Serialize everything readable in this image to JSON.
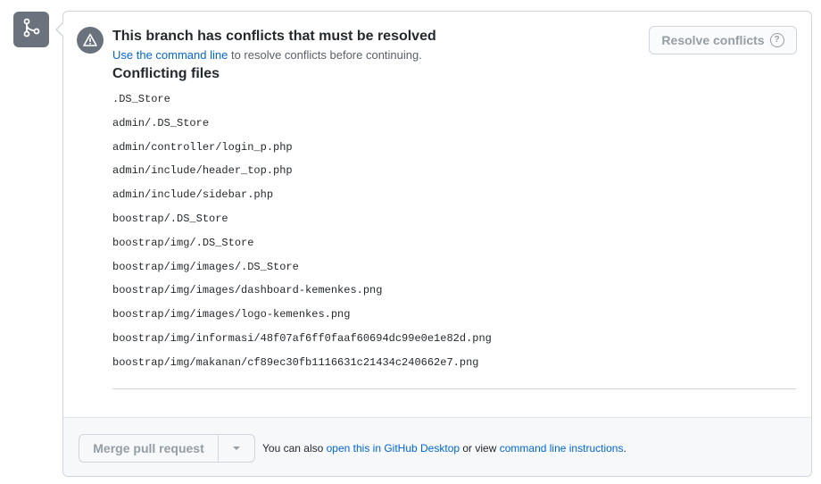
{
  "icons": {
    "branch": "git-merge-icon",
    "alert": "alert-icon",
    "help": "question-circle-icon",
    "dropdown": "chevron-down-icon"
  },
  "colors": {
    "link": "#0366d6",
    "muted": "#959da5",
    "icon_bg": "#6a737d"
  },
  "alert": {
    "title": "This branch has conflicts that must be resolved",
    "subtitle_link": "Use the command line",
    "subtitle_rest": " to resolve conflicts before continuing."
  },
  "resolve_button": {
    "label": "Resolve conflicts",
    "help_glyph": "?"
  },
  "conflicts": {
    "title": "Conflicting files",
    "files": [
      ".DS_Store",
      "admin/.DS_Store",
      "admin/controller/login_p.php",
      "admin/include/header_top.php",
      "admin/include/sidebar.php",
      "boostrap/.DS_Store",
      "boostrap/img/.DS_Store",
      "boostrap/img/images/.DS_Store",
      "boostrap/img/images/dashboard-kemenkes.png",
      "boostrap/img/images/logo-kemenkes.png",
      "boostrap/img/informasi/48f07af6ff0faaf60694dc99e0e1e82d.png",
      "boostrap/img/makanan/cf89ec30fb1116631c21434c240662e7.png"
    ]
  },
  "footer": {
    "merge_label": "Merge pull request",
    "text_prefix": "You can also ",
    "desktop_link": "open this in GitHub Desktop",
    "text_middle": " or view ",
    "cli_link": "command line instructions",
    "text_suffix": "."
  }
}
